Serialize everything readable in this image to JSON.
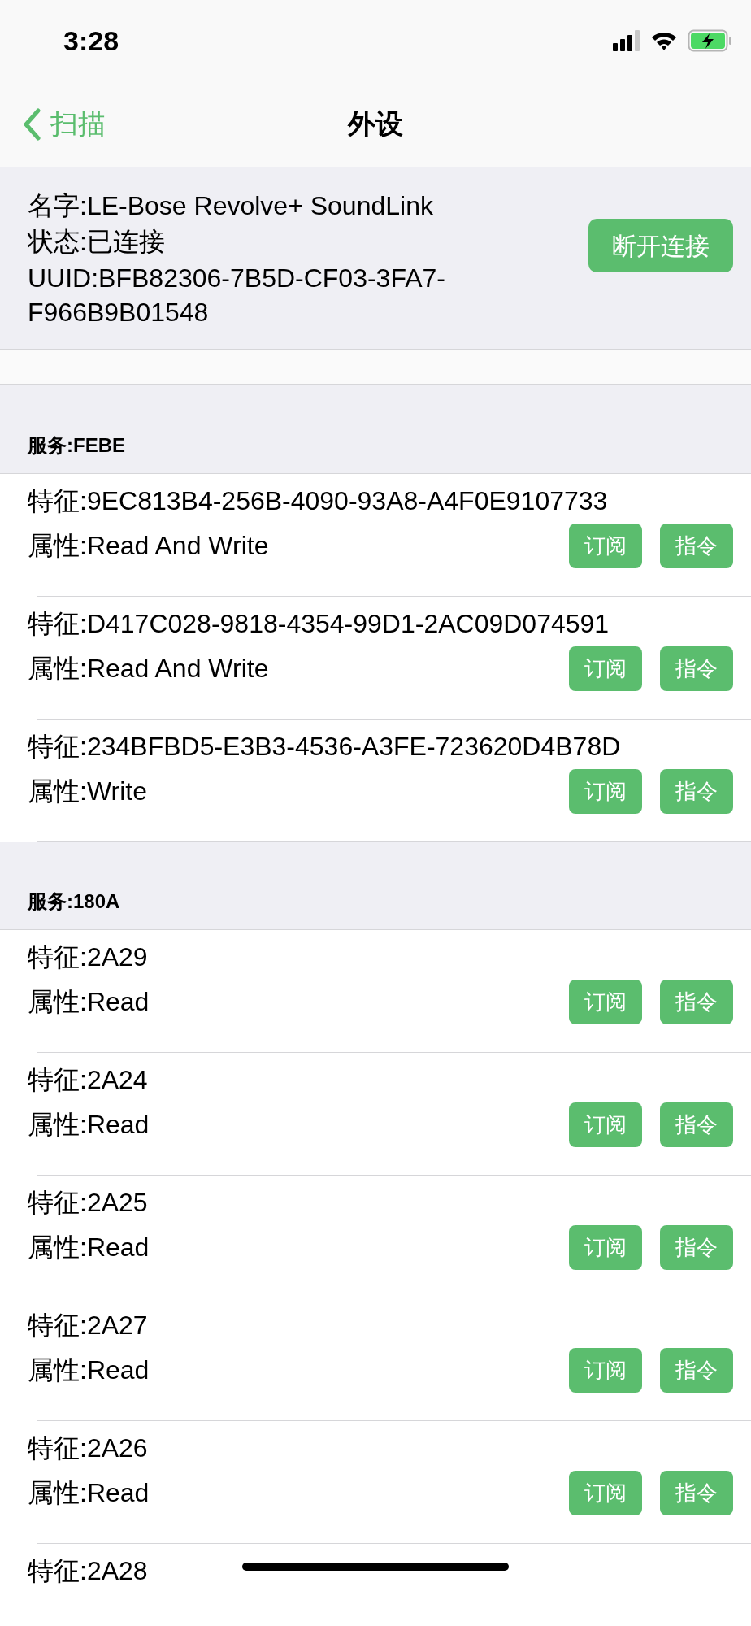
{
  "status_bar": {
    "time": "3:28"
  },
  "nav": {
    "back": "扫描",
    "title": "外设"
  },
  "device": {
    "name": "名字:LE-Bose Revolve+ SoundLink",
    "state": "状态:已连接",
    "uuid": "UUID:BFB82306-7B5D-CF03-3FA7-F966B9B01548",
    "button": "断开连接"
  },
  "services": [
    {
      "title": "服务:FEBE",
      "characteristics": [
        {
          "name": "特征:9EC813B4-256B-4090-93A8-A4F0E9107733",
          "property": "属性:Read And Write",
          "buttons": [
            "订阅",
            "指令"
          ]
        },
        {
          "name": "特征:D417C028-9818-4354-99D1-2AC09D074591",
          "property": "属性:Read And Write",
          "buttons": [
            "订阅",
            "指令"
          ]
        },
        {
          "name": "特征:234BFBD5-E3B3-4536-A3FE-723620D4B78D",
          "property": "属性:Write",
          "buttons": [
            "订阅",
            "指令"
          ]
        }
      ]
    },
    {
      "title": "服务:180A",
      "characteristics": [
        {
          "name": "特征:2A29",
          "property": "属性:Read",
          "buttons": [
            "订阅",
            "指令"
          ]
        },
        {
          "name": "特征:2A24",
          "property": "属性:Read",
          "buttons": [
            "订阅",
            "指令"
          ]
        },
        {
          "name": "特征:2A25",
          "property": "属性:Read",
          "buttons": [
            "订阅",
            "指令"
          ]
        },
        {
          "name": "特征:2A27",
          "property": "属性:Read",
          "buttons": [
            "订阅",
            "指令"
          ]
        },
        {
          "name": "特征:2A26",
          "property": "属性:Read",
          "buttons": [
            "订阅",
            "指令"
          ]
        },
        {
          "name": "特征:2A28"
        }
      ]
    }
  ]
}
